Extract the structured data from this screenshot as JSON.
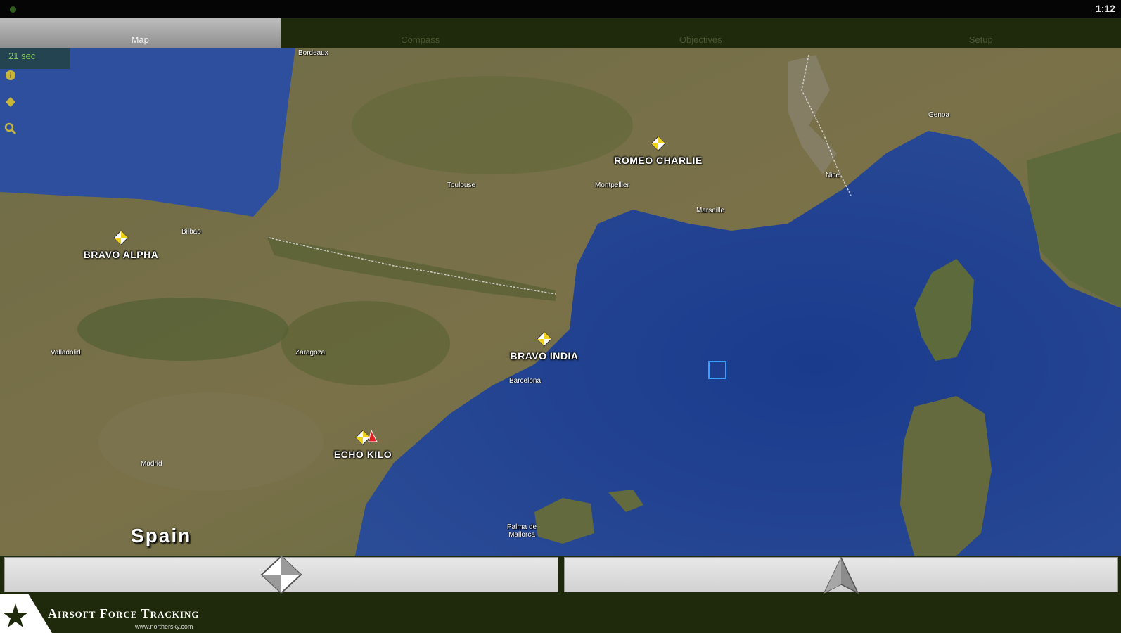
{
  "status_bar": {
    "time": "1:12"
  },
  "tabs": [
    {
      "label": "Map",
      "active": true
    },
    {
      "label": "Compass",
      "active": false
    },
    {
      "label": "Objectives",
      "active": false
    },
    {
      "label": "Setup",
      "active": false
    }
  ],
  "map": {
    "timer": "21 sec",
    "tool_icons": [
      "info-icon",
      "diamond-icon",
      "zoom-icon"
    ],
    "markers": [
      {
        "label": "BRAVO ALPHA",
        "pin": "yellow-white"
      },
      {
        "label": "BRAVO INDIA",
        "pin": "yellow-white"
      },
      {
        "label": "ECHO KILO",
        "pin": "yellow-white-red"
      },
      {
        "label": "ROMEO CHARLIE",
        "pin": "yellow-white"
      }
    ],
    "self_marker_color": "#3aa0ff",
    "country_label": "Spain",
    "places": [
      "Bilbao",
      "Toulouse",
      "Montpellier",
      "Marseille",
      "Nice",
      "Genoa",
      "Barcelona",
      "Valladolid",
      "Madrid",
      "Zaragoza",
      "Palma de Mallorca",
      "Bordeaux"
    ]
  },
  "buttons": {
    "left_icon": "marker-diamond-icon",
    "right_icon": "compass-arrow-icon"
  },
  "footer": {
    "title": "Airsoft Force Tracking",
    "url": "www.northersky.com"
  },
  "colors": {
    "chrome_dark_green": "#1f2a0c",
    "active_tab": "#a9a9a9",
    "sea": "#1f3f8f",
    "land": "#6d6a45"
  }
}
